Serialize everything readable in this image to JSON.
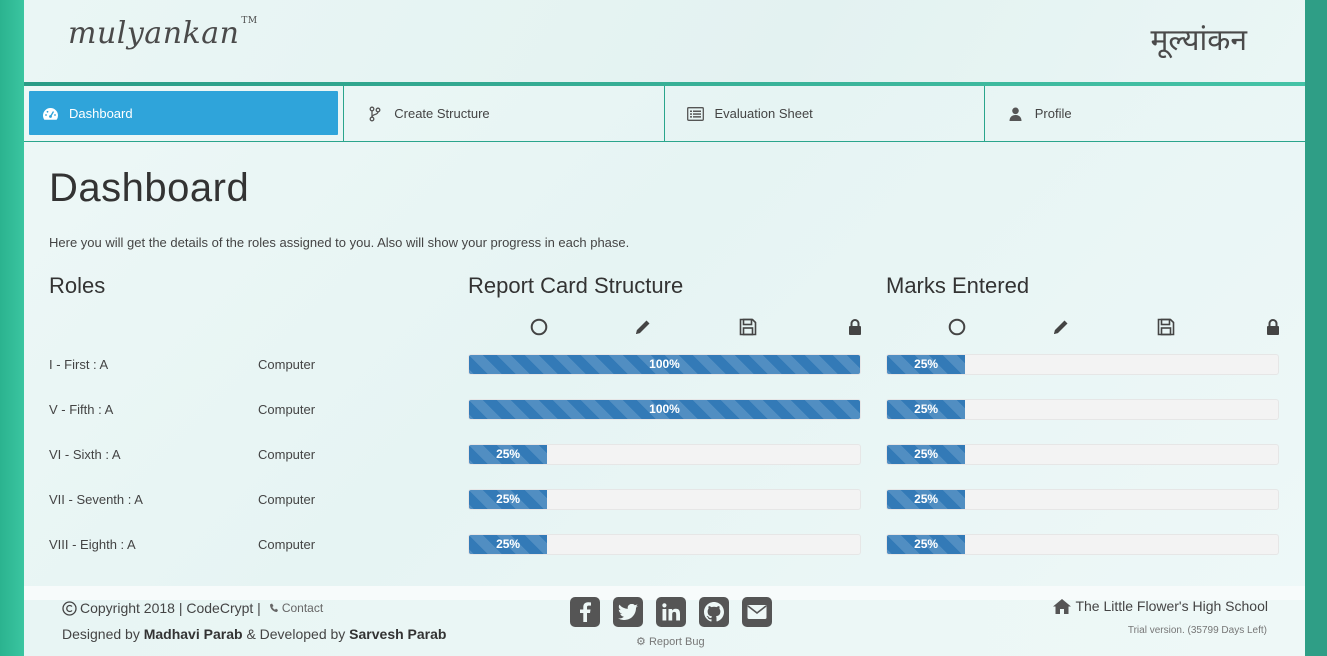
{
  "brand": {
    "logo_text": "mulyankan",
    "logo_tm": "TM",
    "logo_hindi": "मूल्यांकन"
  },
  "nav": {
    "items": [
      {
        "label": "Dashboard",
        "icon": "dashboard-icon",
        "active": true
      },
      {
        "label": "Create Structure",
        "icon": "branch-icon",
        "active": false
      },
      {
        "label": "Evaluation Sheet",
        "icon": "list-icon",
        "active": false
      },
      {
        "label": "Profile",
        "icon": "user-icon",
        "active": false
      }
    ],
    "active_color": "#2fa4da"
  },
  "main": {
    "title": "Dashboard",
    "intro": "Here you will get the details of the roles assigned to you. Also will show your progress in each phase.",
    "columns": {
      "roles": "Roles",
      "structure": "Report Card Structure",
      "marks": "Marks Entered"
    },
    "phase_icons": [
      "circle-icon",
      "pencil-icon",
      "save-icon",
      "lock-icon"
    ],
    "rows": [
      {
        "class": "I - First : A",
        "subject": "Computer",
        "structure_pct": 100,
        "structure_label": "100%",
        "marks_pct": 20,
        "marks_label": "25%"
      },
      {
        "class": "V - Fifth : A",
        "subject": "Computer",
        "structure_pct": 100,
        "structure_label": "100%",
        "marks_pct": 20,
        "marks_label": "25%"
      },
      {
        "class": "VI - Sixth : A",
        "subject": "Computer",
        "structure_pct": 20,
        "structure_label": "25%",
        "marks_pct": 20,
        "marks_label": "25%"
      },
      {
        "class": "VII - Seventh : A",
        "subject": "Computer",
        "structure_pct": 20,
        "structure_label": "25%",
        "marks_pct": 20,
        "marks_label": "25%"
      },
      {
        "class": "VIII - Eighth : A",
        "subject": "Computer",
        "structure_pct": 20,
        "structure_label": "25%",
        "marks_pct": 20,
        "marks_label": "25%"
      }
    ],
    "bar_color": "#337ab7"
  },
  "footer": {
    "copyright": "Copyright 2018 | CodeCrypt |",
    "contact": "Contact",
    "designed_prefix": "Designed by",
    "designer": "Madhavi Parab",
    "developed_prefix": "& Developed by",
    "developer": "Sarvesh Parab",
    "social": [
      "facebook-icon",
      "twitter-icon",
      "linkedin-icon",
      "github-icon",
      "envelope-icon"
    ],
    "report_bug": "Report Bug",
    "school": "The Little Flower's High School",
    "trial": "Trial version. (35799 Days Left)"
  }
}
